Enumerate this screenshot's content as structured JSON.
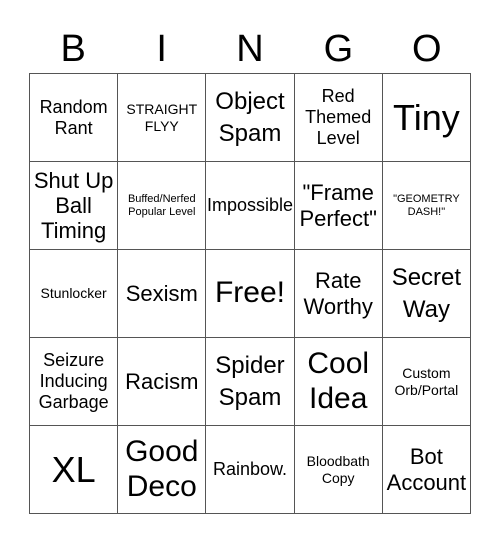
{
  "header": [
    "B",
    "I",
    "N",
    "G",
    "O"
  ],
  "cells": [
    {
      "text": "Random Rant",
      "size": "s-m"
    },
    {
      "text": "STRAIGHT FLYY",
      "size": "s-s"
    },
    {
      "text": "Object Spam",
      "size": "s-xl"
    },
    {
      "text": "Red Themed Level",
      "size": "s-m"
    },
    {
      "text": "Tiny",
      "size": "s-huge"
    },
    {
      "text": "Shut Up Ball Timing",
      "size": "s-l"
    },
    {
      "text": "Buffed/Nerfed Popular Level",
      "size": "s-xs"
    },
    {
      "text": "Impossible",
      "size": "s-m"
    },
    {
      "text": "\"Frame Perfect\"",
      "size": "s-l"
    },
    {
      "text": "\"GEOMETRY DASH!\"",
      "size": "s-xs"
    },
    {
      "text": "Stunlocker",
      "size": "s-s"
    },
    {
      "text": "Sexism",
      "size": "s-l"
    },
    {
      "text": "Free!",
      "size": "s-xxl"
    },
    {
      "text": "Rate Worthy",
      "size": "s-l"
    },
    {
      "text": "Secret Way",
      "size": "s-xl"
    },
    {
      "text": "Seizure Inducing Garbage",
      "size": "s-m"
    },
    {
      "text": "Racism",
      "size": "s-l"
    },
    {
      "text": "Spider Spam",
      "size": "s-xl"
    },
    {
      "text": "Cool Idea",
      "size": "s-xxl"
    },
    {
      "text": "Custom Orb/Portal",
      "size": "s-s"
    },
    {
      "text": "XL",
      "size": "s-huge"
    },
    {
      "text": "Good Deco",
      "size": "s-xxl"
    },
    {
      "text": "Rainbow.",
      "size": "s-m"
    },
    {
      "text": "Bloodbath Copy",
      "size": "s-s"
    },
    {
      "text": "Bot Account",
      "size": "s-l"
    }
  ]
}
